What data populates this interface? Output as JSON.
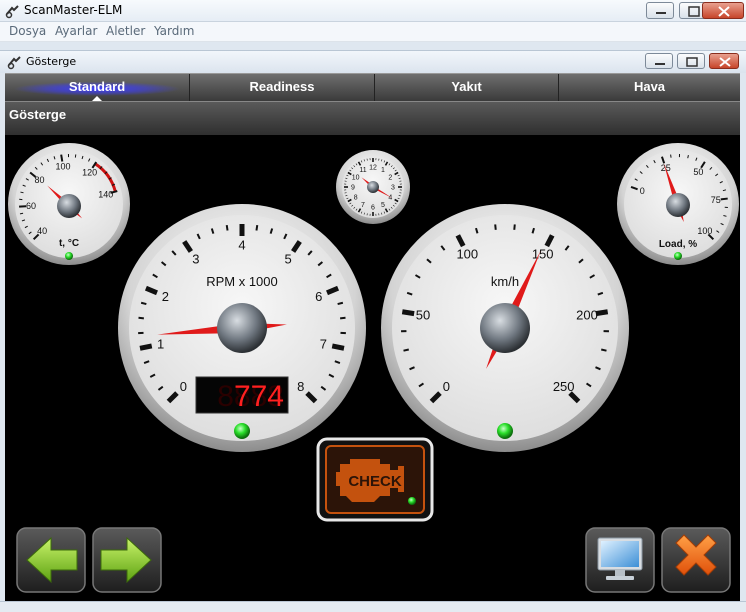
{
  "app": {
    "title": "ScanMaster-ELM",
    "menu": [
      "Dosya",
      "Ayarlar",
      "Aletler",
      "Yardım"
    ]
  },
  "window": {
    "title": "Gösterge"
  },
  "tabs": [
    {
      "label": "Standard",
      "active": true
    },
    {
      "label": "Readiness",
      "active": false
    },
    {
      "label": "Yakıt",
      "active": false
    },
    {
      "label": "Hava",
      "active": false
    }
  ],
  "section": {
    "title": "Gösterge"
  },
  "gauges": {
    "temperature": {
      "label": "t, °C",
      "ticks": [
        "40",
        "60",
        "80",
        "100",
        "120",
        "140"
      ],
      "min": 40,
      "max": 140,
      "value": 82
    },
    "clock": {
      "ticks": [
        "12",
        "1",
        "2",
        "3",
        "4",
        "5",
        "6",
        "7",
        "8",
        "9",
        "10",
        "11"
      ],
      "hour": 10,
      "minute": 20
    },
    "load": {
      "label": "Load, %",
      "ticks": [
        "0",
        "25",
        "50",
        "75",
        "100"
      ],
      "min": 0,
      "max": 100,
      "value": 25
    },
    "rpm": {
      "label": "RPM x 1000",
      "ticks": [
        "0",
        "1",
        "2",
        "3",
        "4",
        "5",
        "6",
        "7",
        "8"
      ],
      "min": 0,
      "max": 8,
      "value": 1.2,
      "digital_readout": "774"
    },
    "speed": {
      "label": "km/h",
      "ticks": [
        "0",
        "50",
        "100",
        "150",
        "200",
        "250"
      ],
      "min": 0,
      "max": 250,
      "value": 148
    }
  },
  "check_engine": {
    "label": "CHECK"
  },
  "colors": {
    "needle": "#e01a1a",
    "led_green": "#2be02b",
    "check_orange": "#c4520e"
  },
  "buttons": {
    "back": {
      "icon": "arrow-left-icon"
    },
    "forward": {
      "icon": "arrow-right-icon"
    },
    "display": {
      "icon": "monitor-icon"
    },
    "close": {
      "icon": "close-x-icon"
    }
  }
}
